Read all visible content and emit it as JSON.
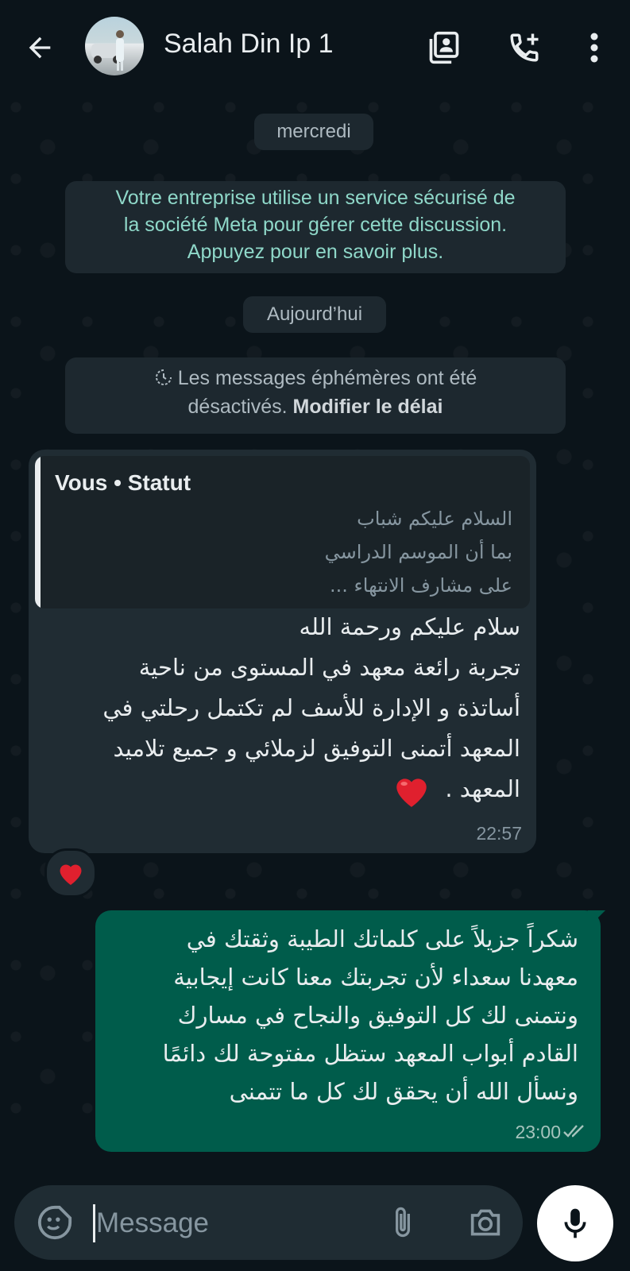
{
  "header": {
    "contact_name": "Salah Din Ip 1",
    "back_icon": "arrow-left-icon",
    "icons": [
      "contact-card-icon",
      "add-call-icon",
      "more-vert-icon"
    ]
  },
  "chat": {
    "date_separator_1": "mercredi",
    "meta_notice": {
      "line1": "Votre entreprise utilise un service sécurisé de",
      "line2": "la société Meta pour gérer cette discussion.",
      "line3": "Appuyez pour en savoir plus."
    },
    "date_separator_2": "Aujourd’hui",
    "ephemeral_notice": {
      "text_line1": "Les messages éphémères ont été",
      "text_line2": "désactivés.",
      "link": "Modifier le délai"
    },
    "incoming": {
      "quote_author": "Vous • Statut",
      "quote_lines": [
        "السلام عليكم شباب",
        "بما أن الموسم الدراسي",
        "على مشارف الانتهاء ..."
      ],
      "lines": [
        "سلام عليكم ورحمة الله",
        "تجربة رائعة معهد في المستوى من ناحية",
        "أساتذة و الإدارة للأسف لم تكتمل رحلتي في",
        "المعهد أتمنى التوفيق لزملائي و جميع تلاميد",
        "المعهد ."
      ],
      "time": "22:57",
      "reaction": "❤️"
    },
    "outgoing": {
      "lines": [
        "شكراً جزيلاً على كلماتك الطيبة وثقتك في",
        "معهدنا سعداء لأن تجربتك معنا كانت إيجابية",
        "ونتمنى لك كل التوفيق والنجاح في مسارك",
        "القادم أبواب المعهد ستظل مفتوحة لك دائمًا",
        "ونسأل الله أن يحقق لك كل ما تتمنى"
      ],
      "time": "23:00",
      "status": "read"
    }
  },
  "composer": {
    "placeholder": "Message",
    "icons": [
      "sticker-icon",
      "attach-icon",
      "camera-icon",
      "mic-icon"
    ]
  },
  "colors": {
    "background": "#0b141a",
    "incoming_bubble": "#202c33",
    "outgoing_bubble": "#005c4b",
    "notice_text": "#8fd8c9"
  }
}
